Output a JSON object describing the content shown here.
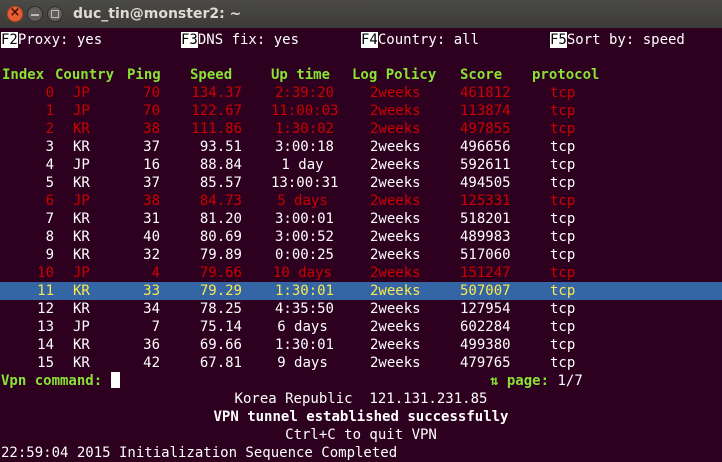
{
  "window": {
    "title": "duc_tin@monster2: ~",
    "close_glyph": "×"
  },
  "toolbar": [
    {
      "key": "F2",
      "label": "Proxy: yes"
    },
    {
      "key": "F3",
      "label": "DNS fix: yes"
    },
    {
      "key": "F4",
      "label": "Country: all"
    },
    {
      "key": "F5",
      "label": "Sort by: speed"
    }
  ],
  "table": {
    "headers": [
      "Index",
      "Country",
      "Ping",
      "Speed",
      "Up time",
      "Log Policy",
      "Score",
      "protocol"
    ],
    "rows": [
      {
        "style": "red",
        "cells": [
          "0",
          "JP",
          "70",
          "134.37",
          "2:39:20",
          "2weeks",
          "461812",
          "tcp"
        ]
      },
      {
        "style": "red",
        "cells": [
          "1",
          "JP",
          "70",
          "122.67",
          "11:00:03",
          "2weeks",
          "113874",
          "tcp"
        ]
      },
      {
        "style": "red",
        "cells": [
          "2",
          "KR",
          "38",
          "111.86",
          "1:30:02",
          "2weeks",
          "497855",
          "tcp"
        ]
      },
      {
        "style": "white",
        "cells": [
          "3",
          "KR",
          "37",
          "93.51",
          "3:00:18",
          "2weeks",
          "496656",
          "tcp"
        ]
      },
      {
        "style": "white",
        "cells": [
          "4",
          "JP",
          "16",
          "88.84",
          "1 day",
          "2weeks",
          "592611",
          "tcp"
        ]
      },
      {
        "style": "white",
        "cells": [
          "5",
          "KR",
          "37",
          "85.57",
          "13:00:31",
          "2weeks",
          "494505",
          "tcp"
        ]
      },
      {
        "style": "red",
        "cells": [
          "6",
          "JP",
          "38",
          "84.73",
          "5 days",
          "2weeks",
          "125331",
          "tcp"
        ]
      },
      {
        "style": "white",
        "cells": [
          "7",
          "KR",
          "31",
          "81.20",
          "3:00:01",
          "2weeks",
          "518201",
          "tcp"
        ]
      },
      {
        "style": "white",
        "cells": [
          "8",
          "KR",
          "40",
          "80.69",
          "3:00:52",
          "2weeks",
          "489983",
          "tcp"
        ]
      },
      {
        "style": "white",
        "cells": [
          "9",
          "KR",
          "32",
          "79.89",
          "0:00:25",
          "2weeks",
          "517060",
          "tcp"
        ]
      },
      {
        "style": "red",
        "cells": [
          "10",
          "JP",
          "4",
          "79.66",
          "10 days",
          "2weeks",
          "151247",
          "tcp"
        ]
      },
      {
        "style": "sel",
        "cells": [
          "11",
          "KR",
          "33",
          "79.29",
          "1:30:01",
          "2weeks",
          "507007",
          "tcp"
        ]
      },
      {
        "style": "white",
        "cells": [
          "12",
          "KR",
          "34",
          "78.25",
          "4:35:50",
          "2weeks",
          "127954",
          "tcp"
        ]
      },
      {
        "style": "white",
        "cells": [
          "13",
          "JP",
          "7",
          "75.14",
          "6 days",
          "2weeks",
          "602284",
          "tcp"
        ]
      },
      {
        "style": "white",
        "cells": [
          "14",
          "KR",
          "36",
          "69.66",
          "1:30:01",
          "2weeks",
          "499380",
          "tcp"
        ]
      },
      {
        "style": "white",
        "cells": [
          "15",
          "KR",
          "42",
          "67.81",
          "9 days",
          "2weeks",
          "479765",
          "tcp"
        ]
      }
    ]
  },
  "prompt": {
    "label": "Vpn command:",
    "value": ""
  },
  "pager": {
    "arrows": "⇅",
    "label": "page:",
    "value": "1/7"
  },
  "status": {
    "country": "Korea Republic",
    "ip": "121.131.231.85",
    "message": "VPN tunnel established successfully",
    "quit_hint": "Ctrl+C to quit VPN",
    "log_line": "22:59:04 2015 Initialization Sequence Completed"
  },
  "colors": {
    "background": "#2c001e",
    "header": "#8ae234",
    "dead_server": "#cc0000",
    "selection": "#3465a4",
    "selected_text": "#fce94f"
  }
}
